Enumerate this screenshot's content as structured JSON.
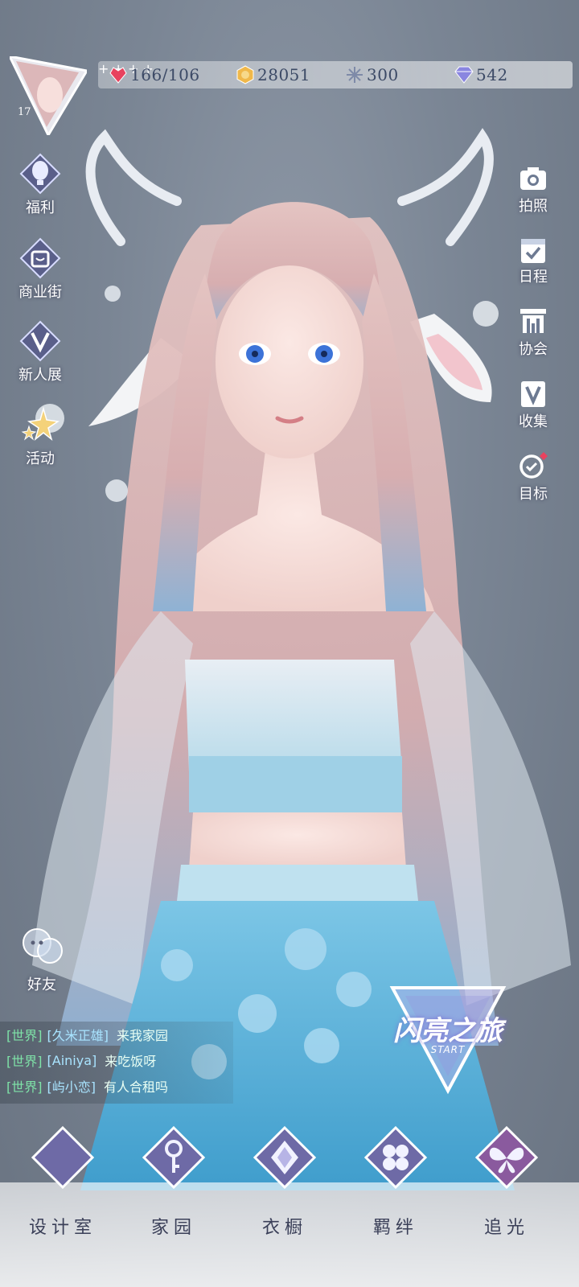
{
  "player": {
    "level": "17"
  },
  "resources": [
    {
      "name": "stamina",
      "icon": "heart-gem-icon",
      "value": "166/106"
    },
    {
      "name": "gold",
      "icon": "coin-icon",
      "value": "28051"
    },
    {
      "name": "crystal",
      "icon": "snowflake-crystal-icon",
      "value": "300"
    },
    {
      "name": "diamond",
      "icon": "diamond-icon",
      "value": "542"
    }
  ],
  "left_menu": [
    {
      "label": "福利",
      "icon": "hot-air-balloon-icon"
    },
    {
      "label": "商业街",
      "icon": "shopping-bag-icon"
    },
    {
      "label": "新人展",
      "icon": "trophy-v-icon"
    },
    {
      "label": "活动",
      "icon": "stars-icon"
    }
  ],
  "right_menu": [
    {
      "label": "拍照",
      "icon": "camera-icon"
    },
    {
      "label": "日程",
      "icon": "calendar-check-icon"
    },
    {
      "label": "协会",
      "icon": "guild-hall-icon"
    },
    {
      "label": "收集",
      "icon": "collection-v-icon"
    },
    {
      "label": "目标",
      "icon": "target-medal-icon"
    }
  ],
  "friends": {
    "label": "好友"
  },
  "chat": [
    {
      "channel": "[世界]",
      "user": "[久米正雄]",
      "message": "来我家园"
    },
    {
      "channel": "[世界]",
      "user": "[Ainiya]",
      "message": "来吃饭呀"
    },
    {
      "channel": "[世界]",
      "user": "[屿小恋]",
      "message": "有人合租吗"
    }
  ],
  "event": {
    "title": "闪亮之旅",
    "subtitle": "START"
  },
  "bottom_nav": [
    {
      "label": "设计室",
      "icon": "moon-studio-icon"
    },
    {
      "label": "家园",
      "icon": "key-home-icon"
    },
    {
      "label": "衣橱",
      "icon": "crystal-wardrobe-icon"
    },
    {
      "label": "羁绊",
      "icon": "clover-bond-icon"
    },
    {
      "label": "追光",
      "icon": "butterfly-light-icon"
    }
  ],
  "colors": {
    "chat_channel": "#7fe3a8",
    "chat_user": "#a9e4ff",
    "plus": "#4d8a74"
  }
}
